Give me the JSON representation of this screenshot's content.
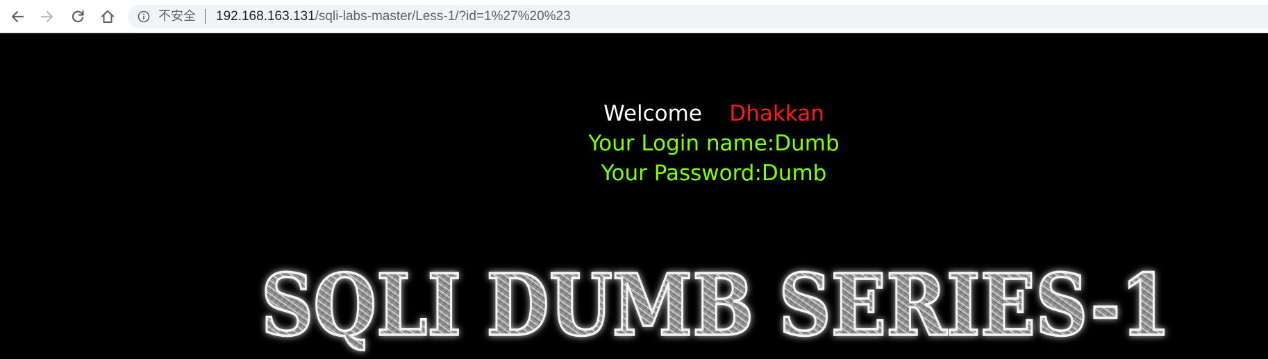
{
  "browser": {
    "security_label": "不安全",
    "url_host": "192.168.163.131",
    "url_path": "/sqli-labs-master/Less-1/?id=1%27%20%23",
    "back_icon": "arrow-left-icon",
    "forward_icon": "arrow-right-icon",
    "reload_icon": "reload-icon",
    "home_icon": "home-icon",
    "info_icon": "info-icon"
  },
  "page": {
    "welcome": "Welcome",
    "user": "Dhakkan",
    "login_line": "Your Login name:Dumb",
    "password_line": "Your Password:Dumb",
    "banner_text": "SQLI DUMB SERIES-1",
    "colors": {
      "background": "#000000",
      "welcome": "#ffffff",
      "user": "#ff1a1a",
      "result": "#7fff00"
    }
  }
}
